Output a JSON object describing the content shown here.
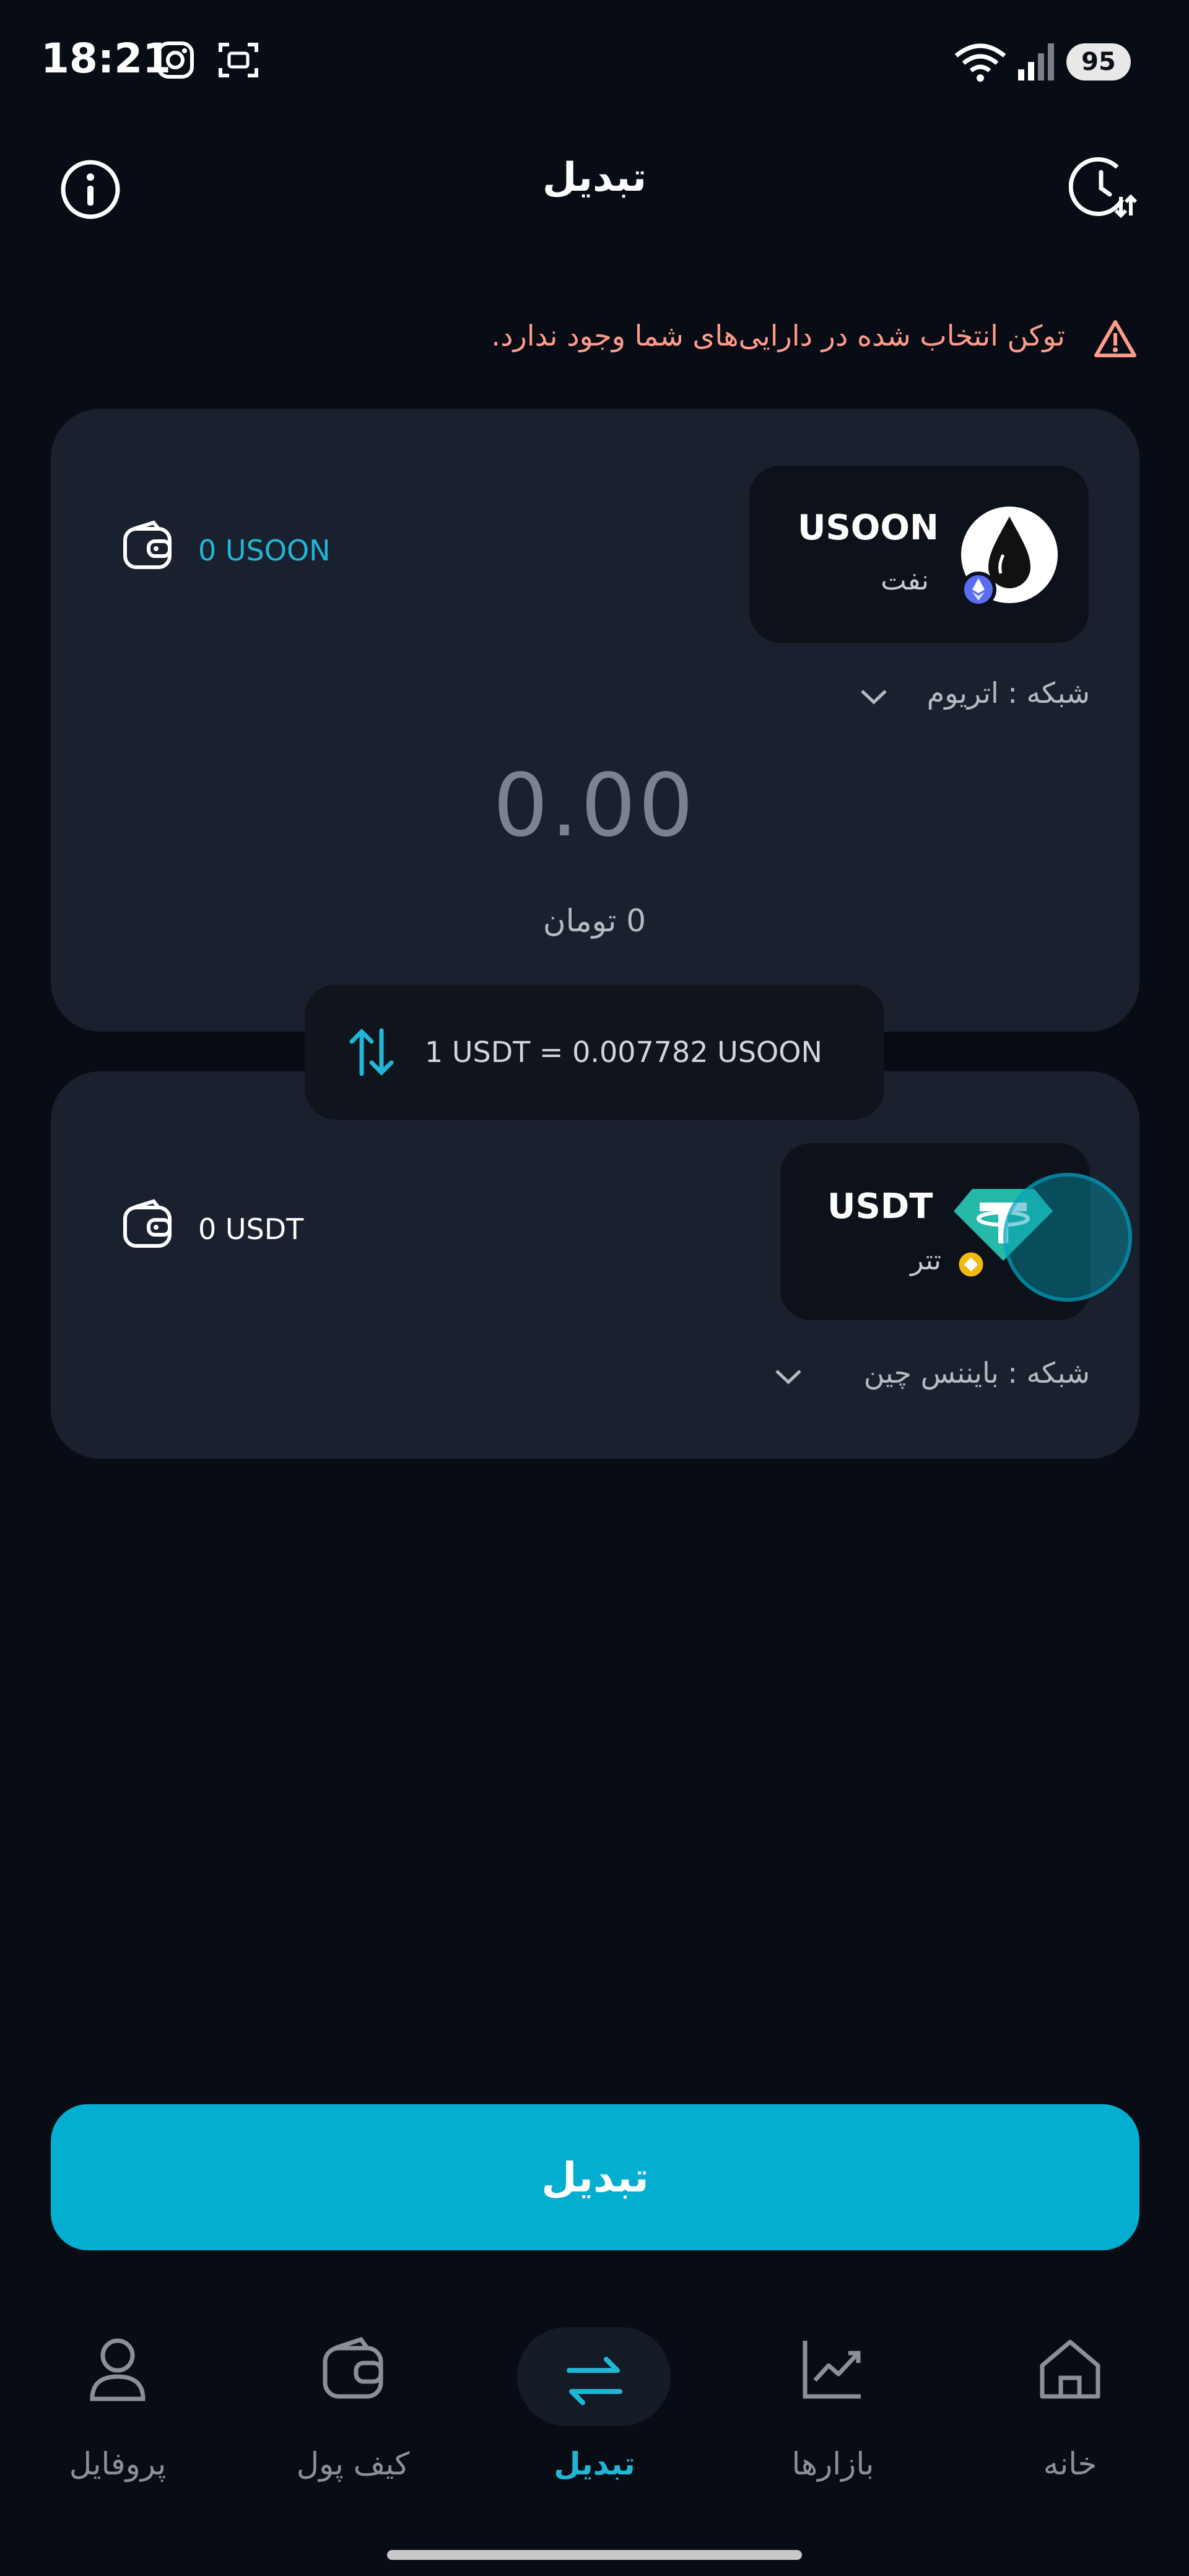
{
  "status_bar": {
    "time": "18:21",
    "battery": "95"
  },
  "header": {
    "title": "تبدیل"
  },
  "warning": {
    "text": "توکن انتخاب شده در دارایی‌های شما وجود ندارد."
  },
  "from_card": {
    "token_symbol": "USOON",
    "token_name": "نفت",
    "network": "شبکه : اتریوم",
    "balance": "0 USOON",
    "amount": "0.00",
    "toman_value": "0 تومان"
  },
  "rate": {
    "text": "1 USDT = 0.007782 USOON"
  },
  "to_card": {
    "token_symbol": "USDT",
    "token_name": "تتر",
    "network": "شبکه : بایننس چین",
    "balance": "0 USDT"
  },
  "swap_button": {
    "label": "تبدیل"
  },
  "bottom_nav": {
    "items": [
      {
        "label": "پروفایل"
      },
      {
        "label": "کیف پول"
      },
      {
        "label": "تبدیل"
      },
      {
        "label": "بازارها"
      },
      {
        "label": "خانه"
      }
    ]
  },
  "colors": {
    "accent": "#03aed0",
    "background": "#080c14",
    "card": "#1a212e",
    "warning": "#ff9b8a"
  }
}
